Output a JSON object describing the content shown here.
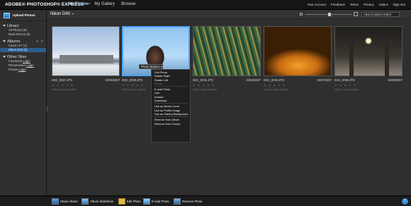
{
  "app": {
    "logo": "ADOBE® PHOTOSHOP® EXPRESS",
    "logo_badge": "BETA"
  },
  "nav": [
    "My Photos",
    "My Gallery",
    "Browse"
  ],
  "top_links": [
    "Your Account",
    "Feedback",
    "Terms",
    "Privacy",
    "Help ▾",
    "Sign Out"
  ],
  "sidebar": {
    "upload": "Upload Photos",
    "library": {
      "title": "Library",
      "items": [
        "All Photos (6)",
        "Most Recent (5)"
      ]
    },
    "albums": {
      "title": "Albums",
      "items": [
        "Canon G7 (1)",
        "Nikon D40 (5)"
      ],
      "selected": 1
    },
    "other_sites": {
      "title": "Other Sites",
      "items": [
        "Facebook",
        "Photobucket",
        "Picasa"
      ],
      "login": "Login"
    }
  },
  "album": {
    "name": "Nikon D40",
    "view_select": "View (Custom Order)"
  },
  "zoom": {
    "level": 0.6
  },
  "photos": [
    {
      "name": "DSC_0007.JPG",
      "date": "02/06/2007",
      "stars": "★ ★ ★ ★ ★",
      "caption": "click to add caption"
    },
    {
      "name": "DSC_0020.JPG",
      "date": "02/06/2007",
      "stars": "★ ★ ★ ★ ★",
      "caption": "click to add caption"
    },
    {
      "name": "DSC_0031.JPG",
      "date": "02/06/2007",
      "stars": "★ ★ ★ ★ ★",
      "caption": "click to add caption"
    },
    {
      "name": "DSC_0034.JPG",
      "date": "02/07/2007",
      "stars": "★ ★ ★ ★ ★",
      "caption": "click to add caption"
    },
    {
      "name": "DSC_0050.JPG",
      "date": "02/08/2007",
      "stars": "★ ★ ★ ★ ★",
      "caption": "click to add caption"
    }
  ],
  "photo_options": "Photo Options ▾",
  "menu": {
    "group1": [
      "Edit Photo",
      "Rotate Right",
      "Rotate Left",
      "Revert"
    ],
    "group2": [
      "E-mail Photo",
      "Link",
      "Embed",
      "Download"
    ],
    "group3": [
      "Use as Album Cover",
      "Use as Profile Image",
      "Use as Gallery Background"
    ],
    "group4": [
      "Remove from Album",
      "Remove from Library"
    ],
    "disabled": "Revert"
  },
  "bottom": [
    "Share Album",
    "Album Slideshow",
    "Edit Photo",
    "E-mail Photo",
    "Remove Photo"
  ],
  "help": "?",
  "colors": {
    "accent": "#4aa4ff",
    "selected_bg": "#2e5d8e",
    "nav_active": "#8dc8f7"
  }
}
